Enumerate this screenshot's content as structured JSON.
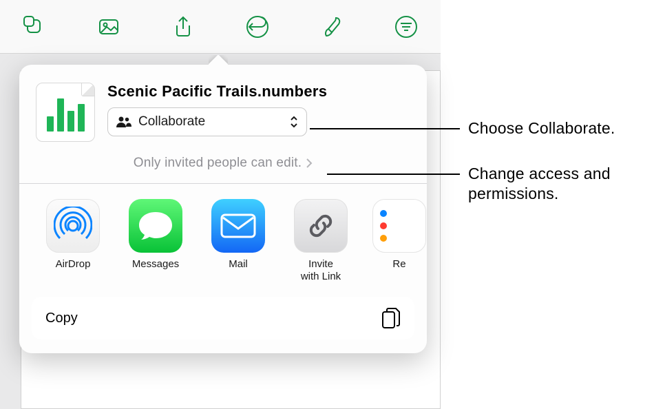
{
  "file": {
    "title": "Scenic Pacific Trails.numbers"
  },
  "collab": {
    "label": "Collaborate"
  },
  "permissions": {
    "text": "Only invited people can edit."
  },
  "share": {
    "airdrop": "AirDrop",
    "messages": "Messages",
    "mail": "Mail",
    "invite": "Invite\nwith Link",
    "reminders": "Reminders"
  },
  "actions": {
    "copy": "Copy"
  },
  "annotations": {
    "a1": "Choose Collaborate.",
    "a2": "Change access and permissions."
  },
  "colors": {
    "accent": "#149145"
  }
}
